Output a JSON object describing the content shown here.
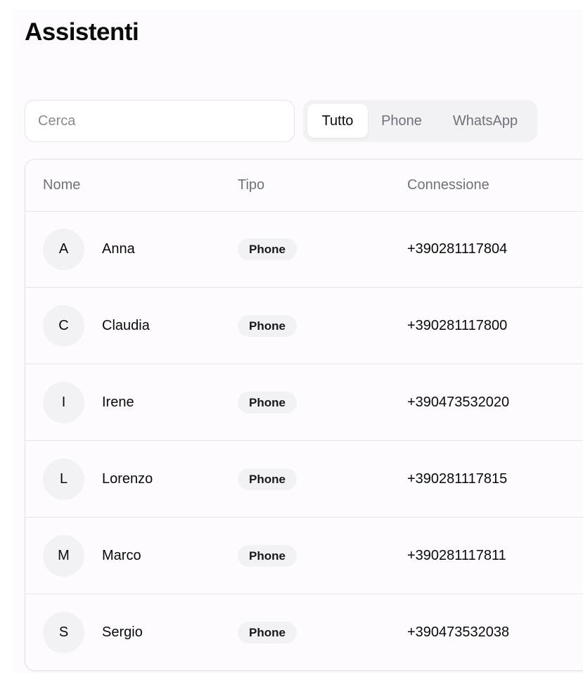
{
  "page": {
    "title": "Assistenti"
  },
  "search": {
    "placeholder": "Cerca",
    "value": ""
  },
  "filters": {
    "selected": "Tutto",
    "options": [
      {
        "label": "Tutto"
      },
      {
        "label": "Phone"
      },
      {
        "label": "WhatsApp"
      }
    ]
  },
  "table": {
    "headers": {
      "nome": "Nome",
      "tipo": "Tipo",
      "connessione": "Connessione"
    },
    "rows": [
      {
        "initial": "A",
        "name": "Anna",
        "type": "Phone",
        "connection": "+390281117804"
      },
      {
        "initial": "C",
        "name": "Claudia",
        "type": "Phone",
        "connection": "+390281117800"
      },
      {
        "initial": "I",
        "name": "Irene",
        "type": "Phone",
        "connection": "+390473532020"
      },
      {
        "initial": "L",
        "name": "Lorenzo",
        "type": "Phone",
        "connection": "+390281117815"
      },
      {
        "initial": "M",
        "name": "Marco",
        "type": "Phone",
        "connection": "+390281117811"
      },
      {
        "initial": "S",
        "name": "Sergio",
        "type": "Phone",
        "connection": "+390473532038"
      }
    ]
  },
  "colors": {
    "text": "#0a0a0a",
    "muted": "#71717a",
    "border": "#e4e4e7",
    "chip": "#f2f2f4",
    "surface": "#fdfbfd"
  }
}
